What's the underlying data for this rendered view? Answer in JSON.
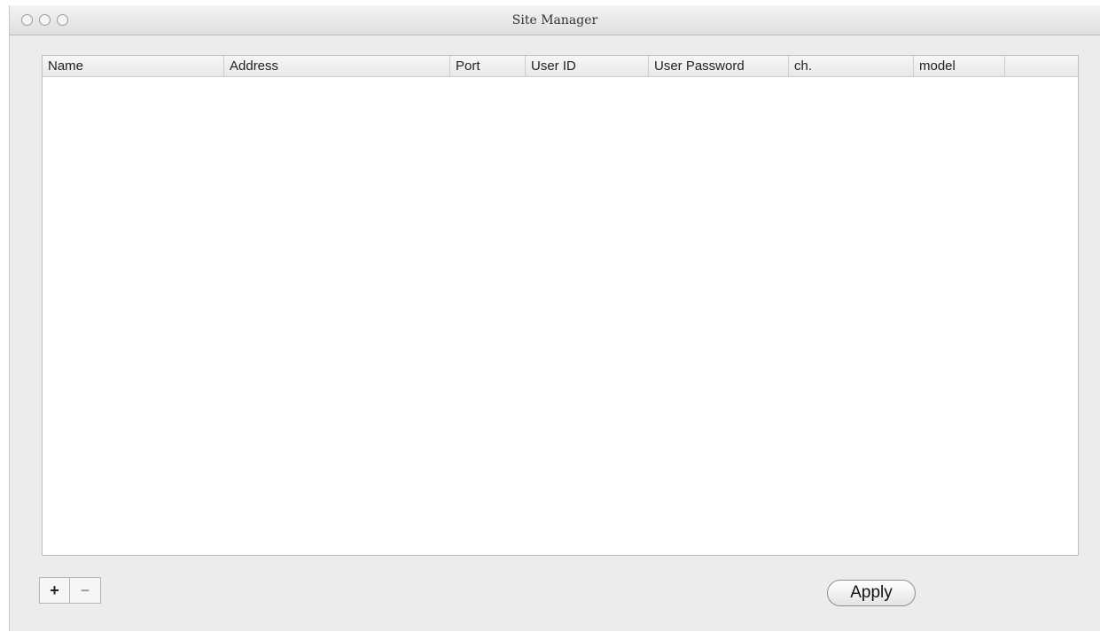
{
  "window": {
    "title": "Site Manager"
  },
  "table": {
    "columns": [
      "Name",
      "Address",
      "Port",
      "User ID",
      "User Password",
      "ch.",
      "model",
      ""
    ],
    "rows": []
  },
  "toolbar": {
    "add_label": "+",
    "remove_label": "−",
    "apply_label": "Apply"
  },
  "icons": {
    "close": "close-icon",
    "minimize": "minimize-icon",
    "zoom": "zoom-icon"
  }
}
